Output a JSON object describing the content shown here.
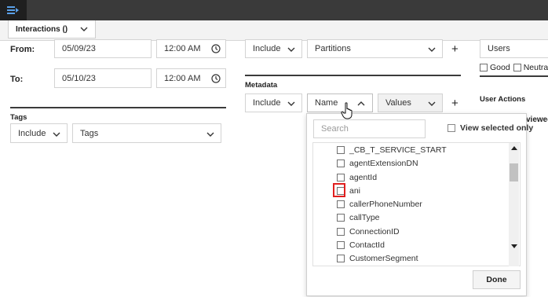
{
  "topbar": {
    "icon": "collapse-menu-icon"
  },
  "tab": {
    "label": "Interactions ()"
  },
  "dates": {
    "from_label": "From:",
    "from_date": "05/09/23",
    "from_time": "12:00 AM",
    "to_label": "To:",
    "to_date": "05/10/23",
    "to_time": "12:00 AM"
  },
  "tags": {
    "title": "Tags",
    "include": "Include",
    "select": "Tags"
  },
  "partitions": {
    "include": "Include",
    "select": "Partitions",
    "plus": "+"
  },
  "metadata": {
    "title": "Metadata",
    "include": "Include",
    "name": "Name",
    "values": "Values",
    "plus": "+"
  },
  "right_panel": {
    "users": "Users",
    "good": "Good",
    "neutral": "Neutral",
    "user_actions": "User Actions",
    "viewed": "viewed"
  },
  "dropdown": {
    "search_placeholder": "Search",
    "view_selected": "View selected only",
    "items": [
      "_CB_T_SERVICE_START",
      "agentExtensionDN",
      "agentId",
      "ani",
      "callerPhoneNumber",
      "callType",
      "ConnectionID",
      "ContactId",
      "CustomerSegment"
    ],
    "done": "Done"
  },
  "colors": {
    "highlight": "#e0201f",
    "topbar": "#3a3a3a"
  }
}
